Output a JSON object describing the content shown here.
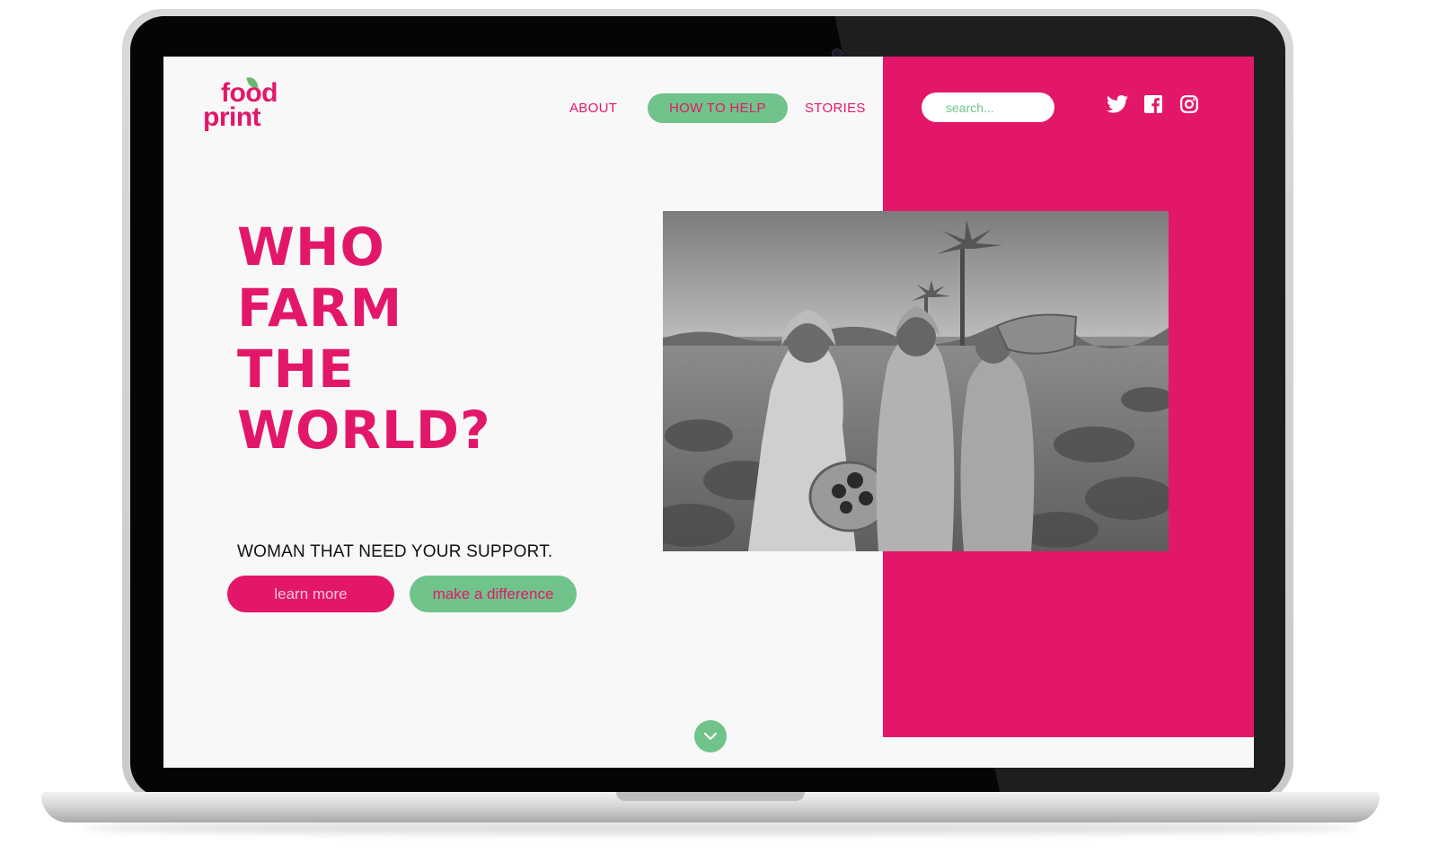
{
  "brand": {
    "logo_line1": "food",
    "logo_line2": "print"
  },
  "nav": {
    "items": [
      {
        "label": "ABOUT",
        "active": false
      },
      {
        "label": "HOW TO HELP",
        "active": true
      },
      {
        "label": "STORIES",
        "active": false
      }
    ]
  },
  "search": {
    "placeholder": "search..."
  },
  "social": [
    "twitter-icon",
    "facebook-icon",
    "instagram-icon"
  ],
  "hero": {
    "headline_lines": [
      "WHO",
      "FARM",
      "THE",
      "WORLD?"
    ],
    "subtext": "WOMAN THAT NEED YOUR SUPPORT.",
    "primary_button": "learn more",
    "secondary_button": "make a difference",
    "image_alt": "Women farmers holding baskets of eggplants in a field"
  },
  "colors": {
    "accent": "#e3176a",
    "green": "#70c38a",
    "background": "#f8f8f8"
  }
}
